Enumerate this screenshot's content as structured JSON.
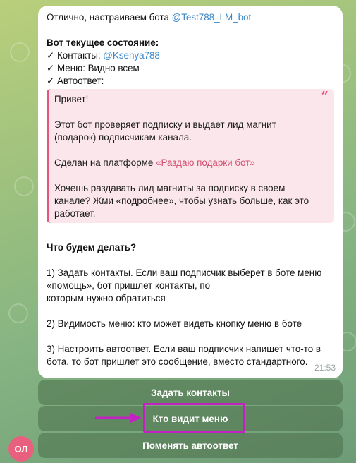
{
  "message": {
    "intro_text": "Отлично, настраиваем бота ",
    "bot_username": "@Test788_LM_bot",
    "state_heading": "Вот текущее состояние:",
    "state_items": [
      {
        "check": "✓",
        "label": "Контакты: ",
        "value": "@Ksenya788"
      },
      {
        "check": "✓",
        "label": "Меню: Видно всем",
        "value": ""
      },
      {
        "check": "✓",
        "label": "Автоответ:",
        "value": ""
      }
    ],
    "quote": {
      "greeting": "Привет!",
      "para1_line1": "Этот бот проверяет подписку и выдает лид магнит",
      "para1_line2": "(подарок) подписчикам канала.",
      "made_on_prefix": "Сделан на платформе ",
      "platform_link": "«Раздаю подарки бот»",
      "para3_line1": "Хочешь раздавать лид магниты за подписку в своем",
      "para3_line2": "канале? Жми «подробнее», чтобы узнать больше, как это",
      "para3_line3": "работает.",
      "quote_icon": "quote-marks-icon"
    },
    "question": "Что будем делать?",
    "options": {
      "opt1_line1": "1) Задать контакты. Если ваш подписчик выберет в боте меню",
      "opt1_line2": "«помощь», бот пришлет контакты, по",
      "opt1_line3": "которым нужно обратиться",
      "opt2": "2) Видимость меню: кто может видеть кнопку меню в боте",
      "opt3_line1": "3) Настроить автоответ. Если ваш подписчик напишет что-то в",
      "opt3_line2": "бота, то бот пришлет это сообщение, вместо стандартного."
    },
    "time": "21:53"
  },
  "keyboard": {
    "buttons": [
      "Задать контакты",
      "Кто видит меню",
      "Поменять автоответ"
    ]
  },
  "avatar": {
    "initials": "ОЛ",
    "color": "#e8607d"
  },
  "colors": {
    "link": "#3a86c8",
    "quote_accent": "#e4557b",
    "highlight_border": "#c322c3"
  }
}
